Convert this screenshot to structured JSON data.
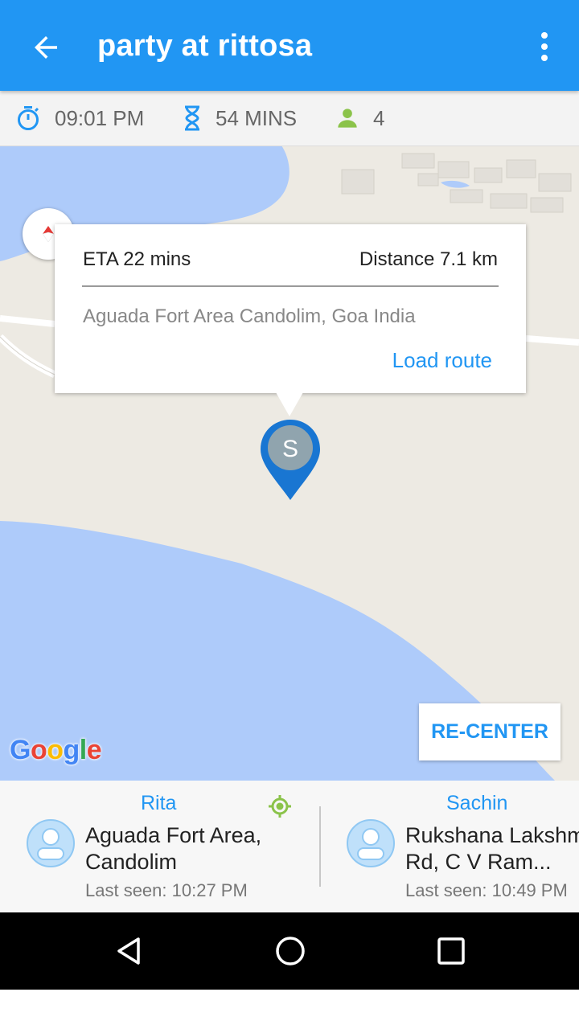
{
  "appbar": {
    "title": "party at rittosa",
    "back_icon": "arrow-left-icon",
    "menu_icon": "more-vert-icon"
  },
  "info": {
    "time": "09:01 PM",
    "duration": "54 MINS",
    "people": "4"
  },
  "popup": {
    "eta": "ETA 22 mins",
    "distance": "Distance 7.1 km",
    "address": "Aguada Fort Area Candolim, Goa India",
    "load_route": "Load route"
  },
  "marker": {
    "initial": "S"
  },
  "map": {
    "recenter": "RE-CENTER",
    "google_logo": "Google"
  },
  "members": [
    {
      "name": "Rita",
      "location_line1": "Aguada Fort Area,",
      "location_line2": "Candolim",
      "last_seen": "Last seen: 10:27 PM"
    },
    {
      "name": "Sachin",
      "location_line1": "Rukshana Lakshmi",
      "location_line2": "Rd, C V Ram...",
      "last_seen": "Last seen: 10:49 PM"
    }
  ],
  "colors": {
    "primary": "#2196F3",
    "water": "#AECBFA",
    "land": "#EDEAE3",
    "marker": "#1976D2",
    "person_icon": "#8BC34A"
  }
}
